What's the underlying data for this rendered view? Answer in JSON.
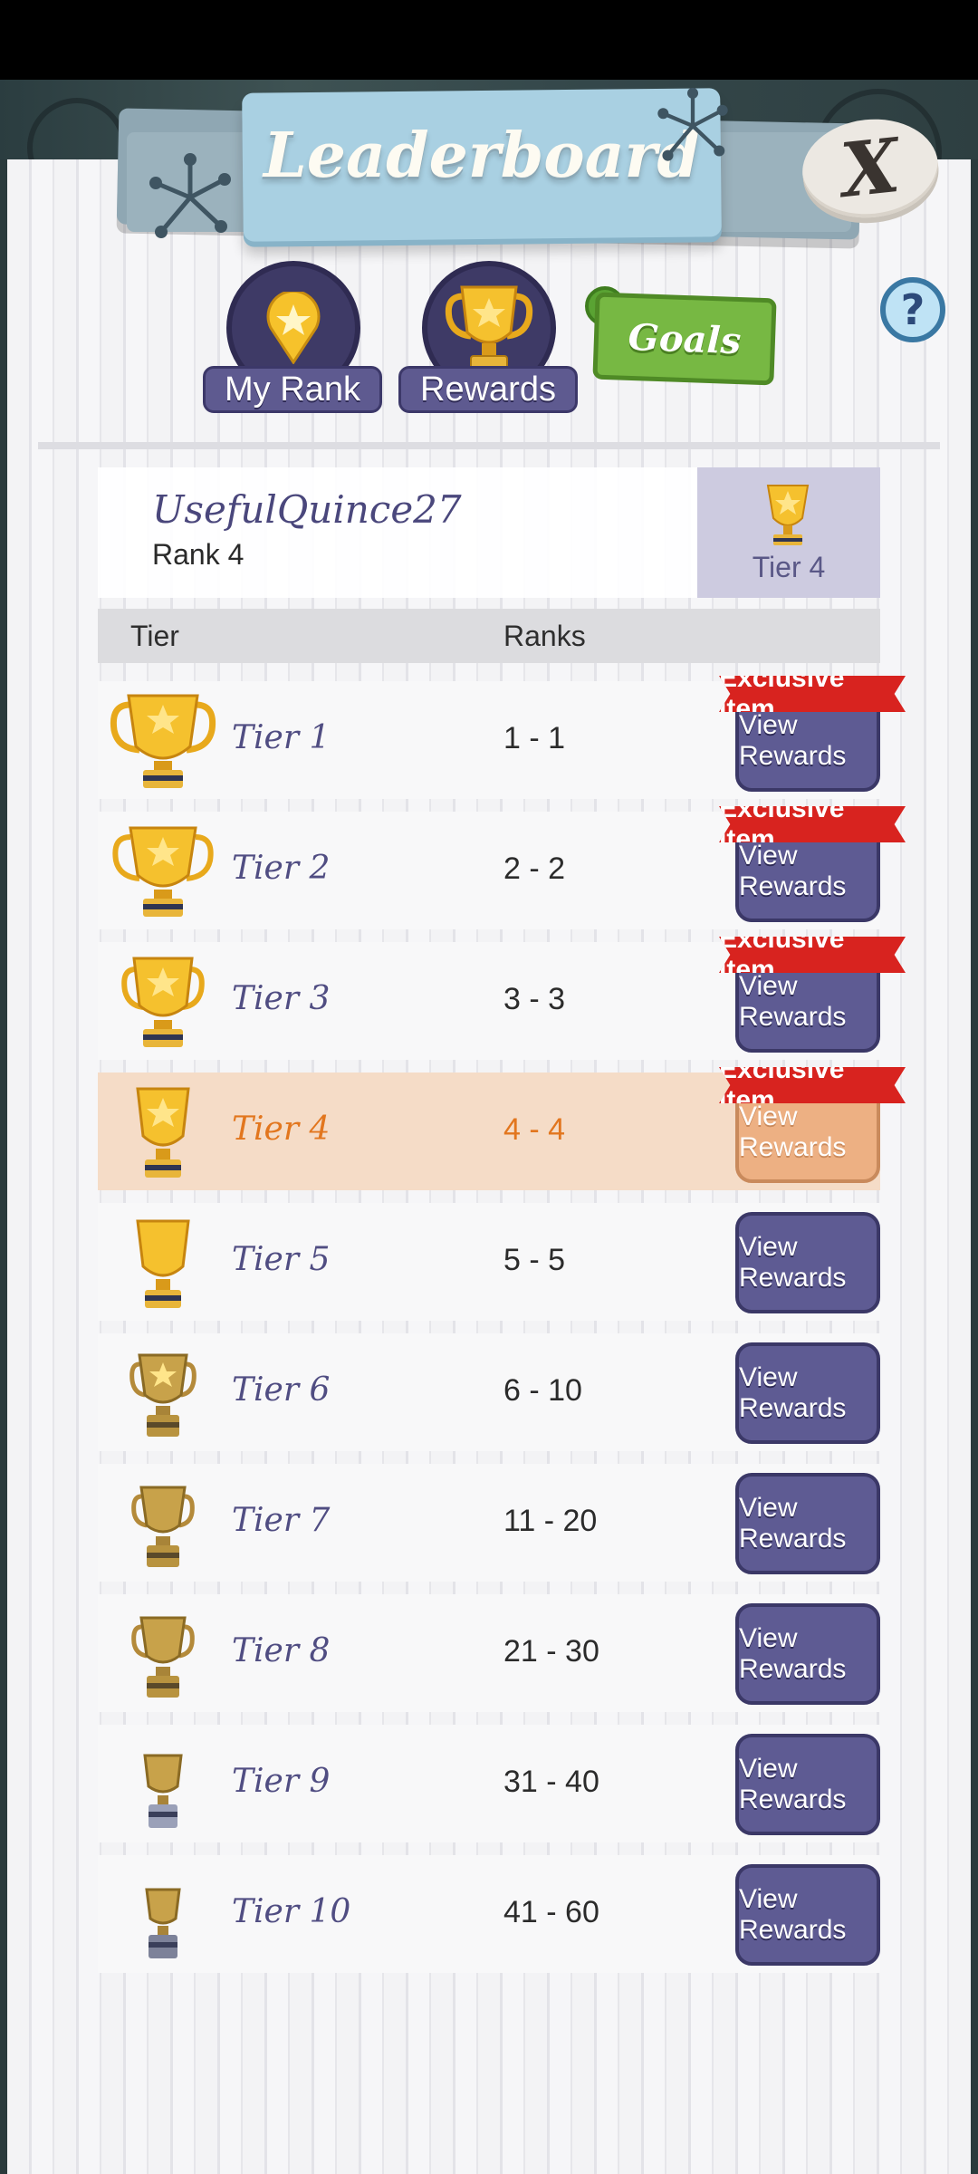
{
  "header": {
    "title": "Leaderboard",
    "close_label": "X"
  },
  "tabs": [
    {
      "label": "My Rank",
      "icon": "map-pin-star-icon"
    },
    {
      "label": "Rewards",
      "icon": "trophy-icon"
    }
  ],
  "goals_label": "Goals",
  "help_label": "?",
  "player": {
    "name": "UsefulQuince27",
    "rank": "Rank 4",
    "tier": "Tier 4"
  },
  "table": {
    "headers": {
      "tier": "Tier",
      "ranks": "Ranks"
    },
    "ribbon_label": "Exclusive Item",
    "button_label": "View Rewards",
    "rows": [
      {
        "tier": "Tier 1",
        "ranks": "1 - 1",
        "exclusive": true
      },
      {
        "tier": "Tier 2",
        "ranks": "2 - 2",
        "exclusive": true
      },
      {
        "tier": "Tier 3",
        "ranks": "3 - 3",
        "exclusive": true
      },
      {
        "tier": "Tier 4",
        "ranks": "4 - 4",
        "exclusive": true,
        "current": true
      },
      {
        "tier": "Tier 5",
        "ranks": "5 - 5",
        "exclusive": false
      },
      {
        "tier": "Tier 6",
        "ranks": "6 - 10",
        "exclusive": false
      },
      {
        "tier": "Tier 7",
        "ranks": "11 - 20",
        "exclusive": false
      },
      {
        "tier": "Tier 8",
        "ranks": "21 - 30",
        "exclusive": false
      },
      {
        "tier": "Tier 9",
        "ranks": "31 - 40",
        "exclusive": false
      },
      {
        "tier": "Tier 10",
        "ranks": "41 - 60",
        "exclusive": false
      }
    ]
  },
  "colors": {
    "accent_purple": "#5e5b93",
    "current_highlight": "#f5dcc7",
    "current_text": "#e2761e",
    "ribbon_red": "#d8231f",
    "goals_green": "#77b843"
  }
}
